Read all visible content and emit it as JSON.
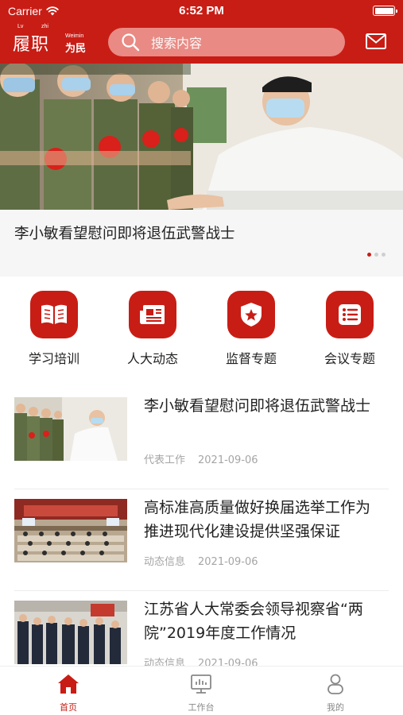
{
  "status_bar": {
    "carrier": "Carrier",
    "time": "6:52 PM"
  },
  "header": {
    "logo_pinyin_1": "Lv",
    "logo_pinyin_2": "zhi",
    "logo_big": "履职",
    "logo_small_pinyin": "Weimin",
    "logo_small": "为民",
    "search_placeholder": "搜索内容",
    "mail_icon": "mail-icon",
    "brand_color": "#c81d15"
  },
  "banner": {
    "caption": "李小敏看望慰问即将退伍武警战士",
    "page_count": 3,
    "current_page": 1
  },
  "categories": [
    {
      "label": "学习培训",
      "icon": "book-icon"
    },
    {
      "label": "人大动态",
      "icon": "newspaper-icon"
    },
    {
      "label": "监督专题",
      "icon": "police-badge-icon"
    },
    {
      "label": "会议专题",
      "icon": "list-icon"
    }
  ],
  "news": [
    {
      "title": "李小敏看望慰问即将退伍武警战士",
      "category": "代表工作",
      "date": "2021-09-06"
    },
    {
      "title": "高标准高质量做好换届选举工作为推进现代化建设提供坚强保证",
      "category": "动态信息",
      "date": "2021-09-06"
    },
    {
      "title": "江苏省人大常委会领导视察省“两院”2019年度工作情况",
      "category": "动态信息",
      "date": "2021-09-06"
    }
  ],
  "tabbar": [
    {
      "label": "首页",
      "icon": "home-icon",
      "active": true
    },
    {
      "label": "工作台",
      "icon": "monitor-icon",
      "active": false
    },
    {
      "label": "我的",
      "icon": "user-icon",
      "active": false
    }
  ]
}
